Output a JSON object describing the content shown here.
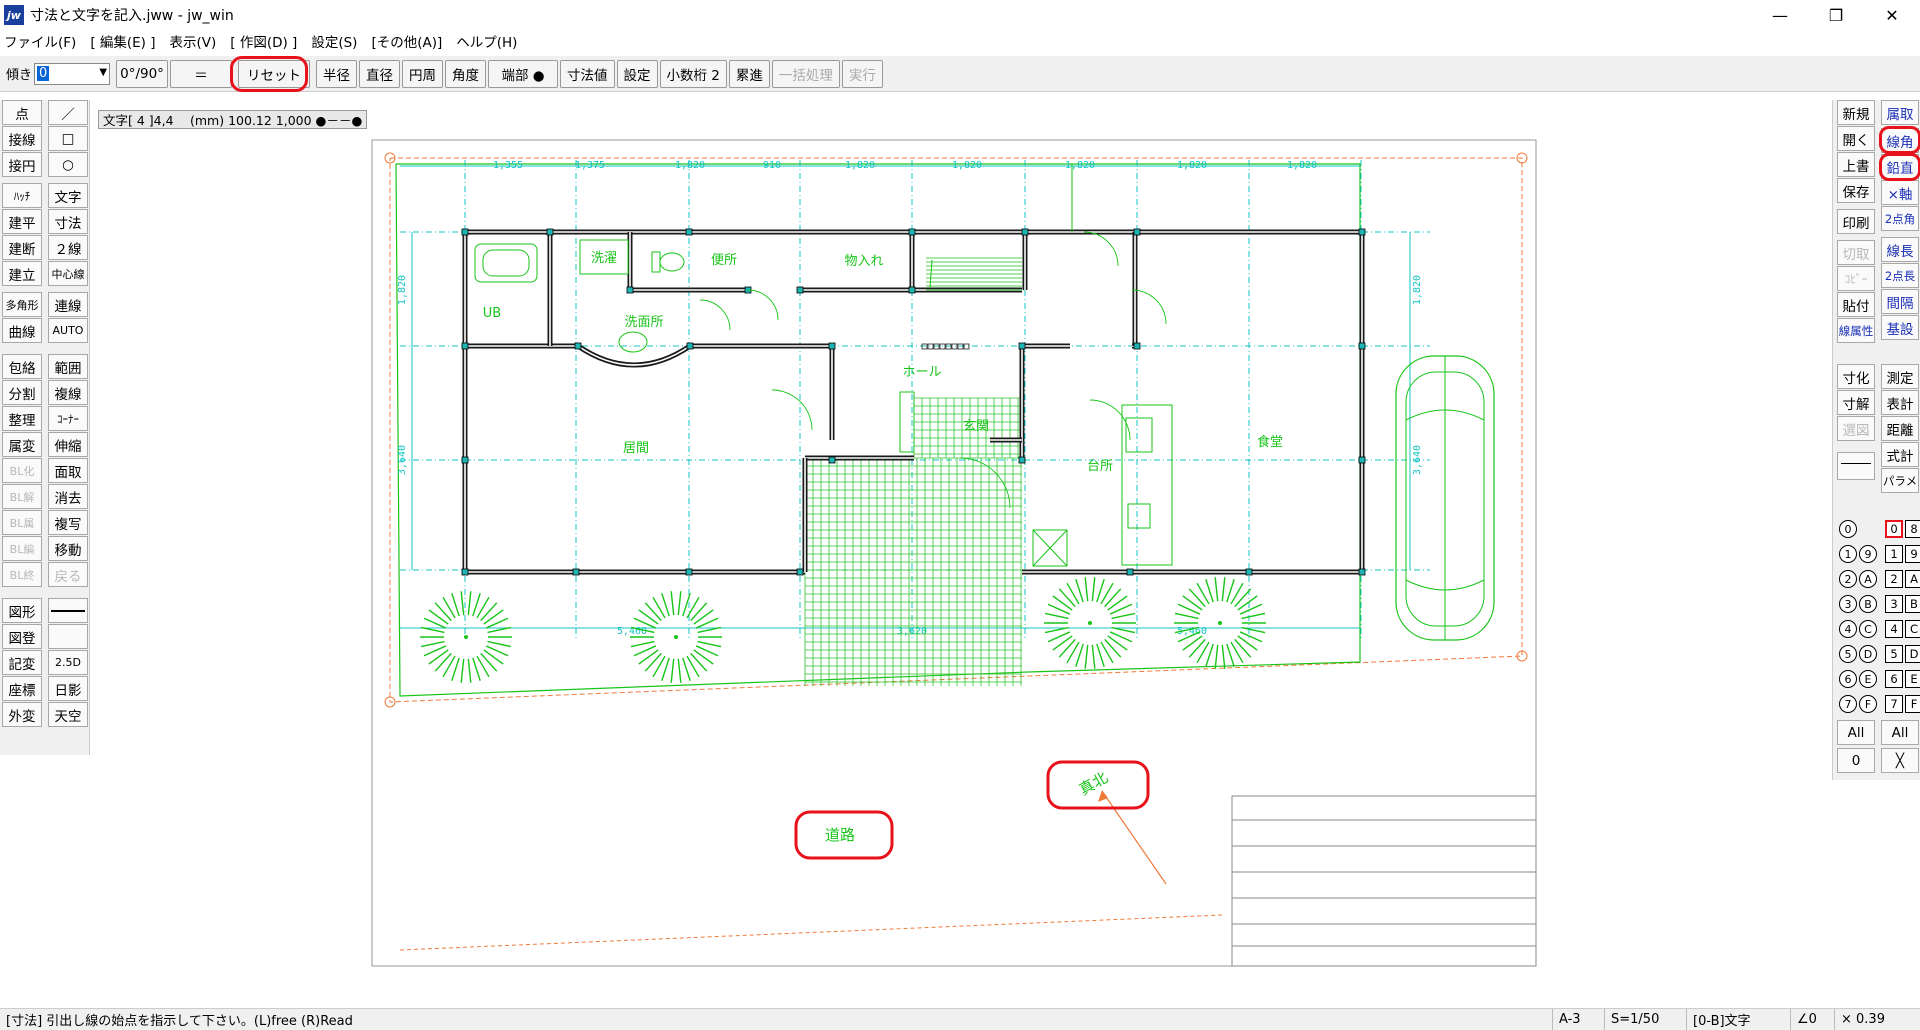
{
  "window": {
    "title": "寸法と文字を記入.jww - jw_win",
    "icon": "jw",
    "controls": [
      "—",
      "❐",
      "✕"
    ]
  },
  "menu": [
    "ファイル(F)",
    "[ 編集(E) ]",
    "表示(V)",
    "[ 作図(D) ]",
    "設定(S)",
    "[その他(A)]",
    "ヘルプ(H)"
  ],
  "toolbar": {
    "tilt_label": "傾き",
    "tilt_value": "0",
    "angle_toggle": "0°/90°",
    "equals": "＝",
    "buttons": [
      "リセット",
      "半径",
      "直径",
      "円周",
      "角度",
      "端部 ●",
      "寸法値",
      "設定",
      "小数桁 2",
      "累進"
    ],
    "disabled_buttons": [
      "一括処理",
      "実行"
    ]
  },
  "left_palette": {
    "left": [
      "点",
      "接線",
      "接円",
      "ﾊｯﾁ",
      "建平",
      "建断",
      "建立",
      "多角形",
      "曲線",
      "包絡",
      "分割",
      "整理",
      "属変",
      "BL化",
      "BL解",
      "BL属",
      "BL編",
      "BL終",
      "図形",
      "図登",
      "記変",
      "座標",
      "外変"
    ],
    "right": [
      "／",
      "□",
      "○",
      "文字",
      "寸法",
      "２線",
      "中心線",
      "連線",
      "AUTO",
      "範囲",
      "複線",
      "ｺｰﾅｰ",
      "伸縮",
      "面取",
      "消去",
      "複写",
      "移動",
      "戻る",
      "",
      "",
      "2.5D",
      "日影",
      "天空"
    ],
    "disabled": [
      "BL化",
      "BL解",
      "BL属",
      "BL編",
      "BL終",
      "戻る"
    ]
  },
  "right_palette": {
    "left": [
      "新規",
      "開く",
      "上書",
      "保存",
      "印刷",
      "切取",
      "ｺﾋﾟｰ",
      "貼付",
      "線属性",
      "寸化",
      "寸解",
      "選図"
    ],
    "right": [
      "属取",
      "線角",
      "鉛直",
      "×軸",
      "2点角",
      "線長",
      "2点長",
      "間隔",
      "基設",
      "測定",
      "表計",
      "距離",
      "式計",
      "パラメ"
    ],
    "disabled": [
      "切取",
      "ｺﾋﾟｰ",
      "選図"
    ],
    "layer_groups": [
      "⓪",
      "①",
      "②",
      "③",
      "④",
      "⑤",
      "⑥",
      "⑦"
    ],
    "layer_groups_2": [
      "⑨",
      "Ⓐ",
      "Ⓑ",
      "Ⓒ",
      "Ⓓ",
      "Ⓔ",
      "Ⓕ"
    ],
    "layers_left": [
      "0",
      "1",
      "2",
      "3",
      "4",
      "5",
      "6",
      "7"
    ],
    "layers_right": [
      "8",
      "9",
      "A",
      "B",
      "C",
      "D",
      "E",
      "F"
    ],
    "all_label": "All",
    "zero_label": "0",
    "x_label": "╳"
  },
  "text_info": "文字[ 4 ]4,4 　(mm) 100.12 1,000 ●－－●",
  "drawing": {
    "dims_top": [
      "1,355",
      "1,375",
      "1,820",
      "910",
      "1,820",
      "1,820",
      "1,820",
      "1,820",
      "1,820"
    ],
    "dims_bottom": [
      "5,460",
      "3,620",
      "5,460"
    ],
    "dims_side": [
      "1,820",
      "3,640",
      "1,820",
      "3,640"
    ],
    "rooms": [
      "洗濯",
      "便所",
      "物入れ",
      "UB",
      "洗面所",
      "ホール",
      "居間",
      "玄関",
      "台所",
      "食堂"
    ],
    "annotations": {
      "road": "道路",
      "north": "真北"
    },
    "colors": {
      "wall": "#1a1a1a",
      "green": "#19c419",
      "cyan": "#14c4c4",
      "orange": "#f07a3a",
      "grid": "#2ec42e"
    }
  },
  "statusbar": {
    "message": "[寸法] 引出し線の始点を指示して下さい。(L)free  (R)Read",
    "paper": "A-3",
    "scale": "S=1/50",
    "layer": "[0-B]文字",
    "angle": "∠0",
    "zoom": "× 0.39"
  }
}
